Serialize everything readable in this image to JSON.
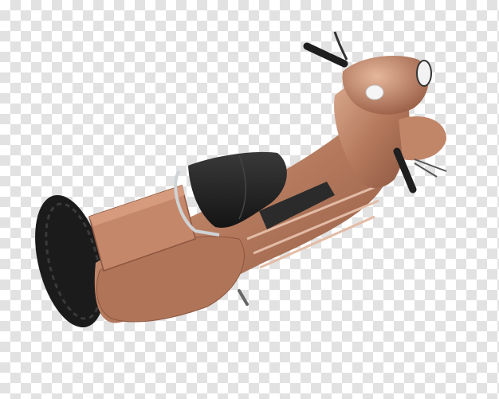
{
  "image": {
    "subject": "scooter",
    "background": "transparency-checkerboard",
    "colors": {
      "body": "#b57a5e",
      "body_dark": "#8c5640",
      "body_light": "#d9a98d",
      "seat": "#2a2a2a",
      "tire": "#1b1b1b",
      "chrome": "#cfd3d6",
      "checker_light": "#ffffff",
      "checker_dark": "#e2e2e2"
    }
  }
}
